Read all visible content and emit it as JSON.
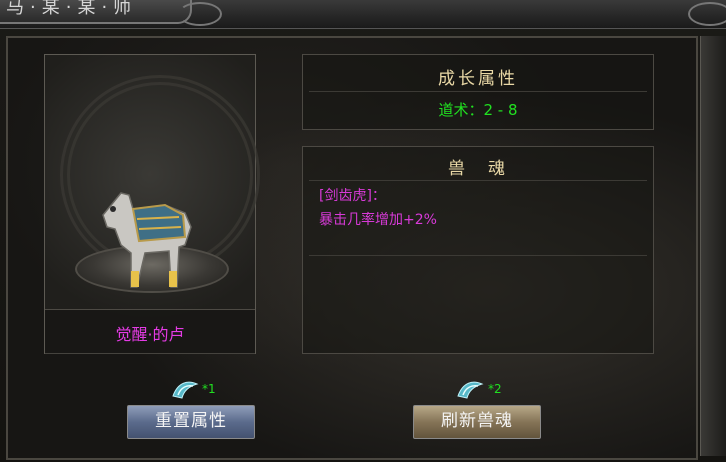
{
  "window": {
    "title": "马·某·某·师"
  },
  "preview": {
    "mount_name": "觉醒·的卢"
  },
  "growth": {
    "title": "成长属性",
    "attribute": "道术：2 - 8"
  },
  "soul": {
    "title": "兽　魂",
    "lines": [
      "[剑齿虎]：",
      "暴击几率增加+2%"
    ]
  },
  "actions": {
    "reset": {
      "cost_count": "*1",
      "label": "重置属性"
    },
    "refresh": {
      "cost_count": "*2",
      "label": "刷新兽魂"
    }
  },
  "colors": {
    "attribute_green": "#21e021",
    "soul_purple": "#d83ad8",
    "mount_name": "#e43be4",
    "header_gold": "#e9d8a6"
  }
}
